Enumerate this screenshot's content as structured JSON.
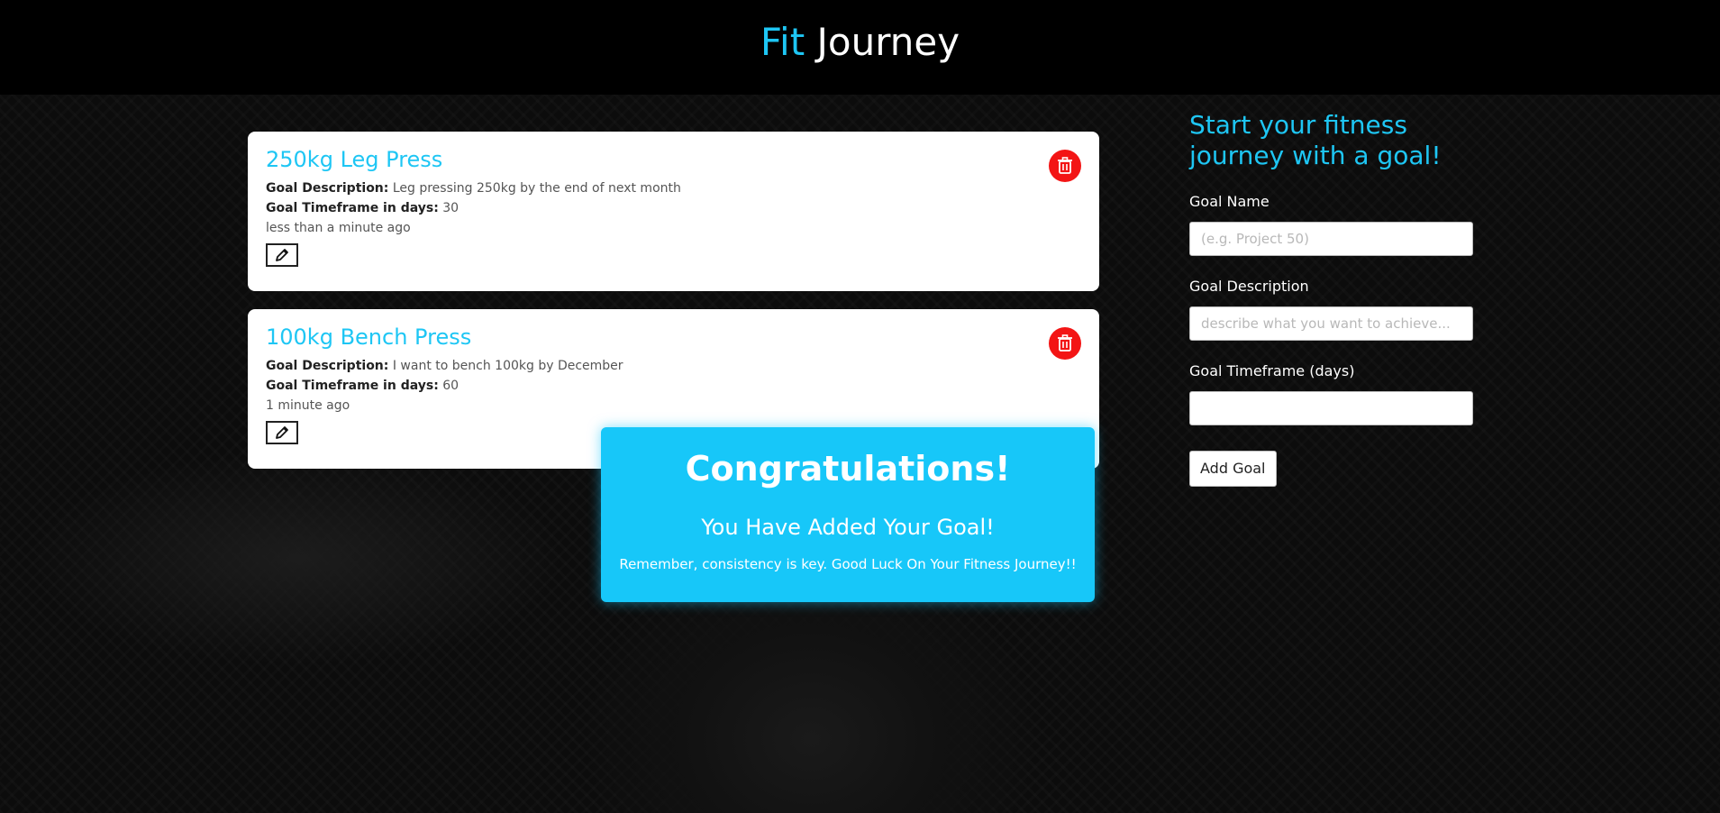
{
  "header": {
    "title_accent": "Fit",
    "title_rest": " Journey"
  },
  "goals": [
    {
      "title": "250kg Leg Press",
      "description_label": "Goal Description:",
      "description": "Leg pressing 250kg by the end of next month",
      "timeframe_label": "Goal Timeframe in days:",
      "timeframe": "30",
      "created": "less than a minute ago"
    },
    {
      "title": "100kg Bench Press",
      "description_label": "Goal Description:",
      "description": "I want to bench 100kg by December",
      "timeframe_label": "Goal Timeframe in days:",
      "timeframe": "60",
      "created": "1 minute ago"
    }
  ],
  "form": {
    "heading": "Start your fitness journey with a goal!",
    "name_label": "Goal Name",
    "name_placeholder": "(e.g. Project 50)",
    "description_label": "Goal Description",
    "description_placeholder": "describe what you want to achieve...",
    "timeframe_label": "Goal Timeframe (days)",
    "timeframe_value": "",
    "submit_label": "Add Goal"
  },
  "toast": {
    "title": "Congratulations!",
    "subtitle": "You Have Added Your Goal!",
    "message": "Remember, consistency is key. Good Luck On Your Fitness Journey!!"
  },
  "icons": {
    "delete": "trash-icon",
    "edit": "pencil-icon"
  },
  "colors": {
    "accent": "#1ec6f4",
    "delete": "#f31515",
    "toast": "#17c7f9"
  }
}
